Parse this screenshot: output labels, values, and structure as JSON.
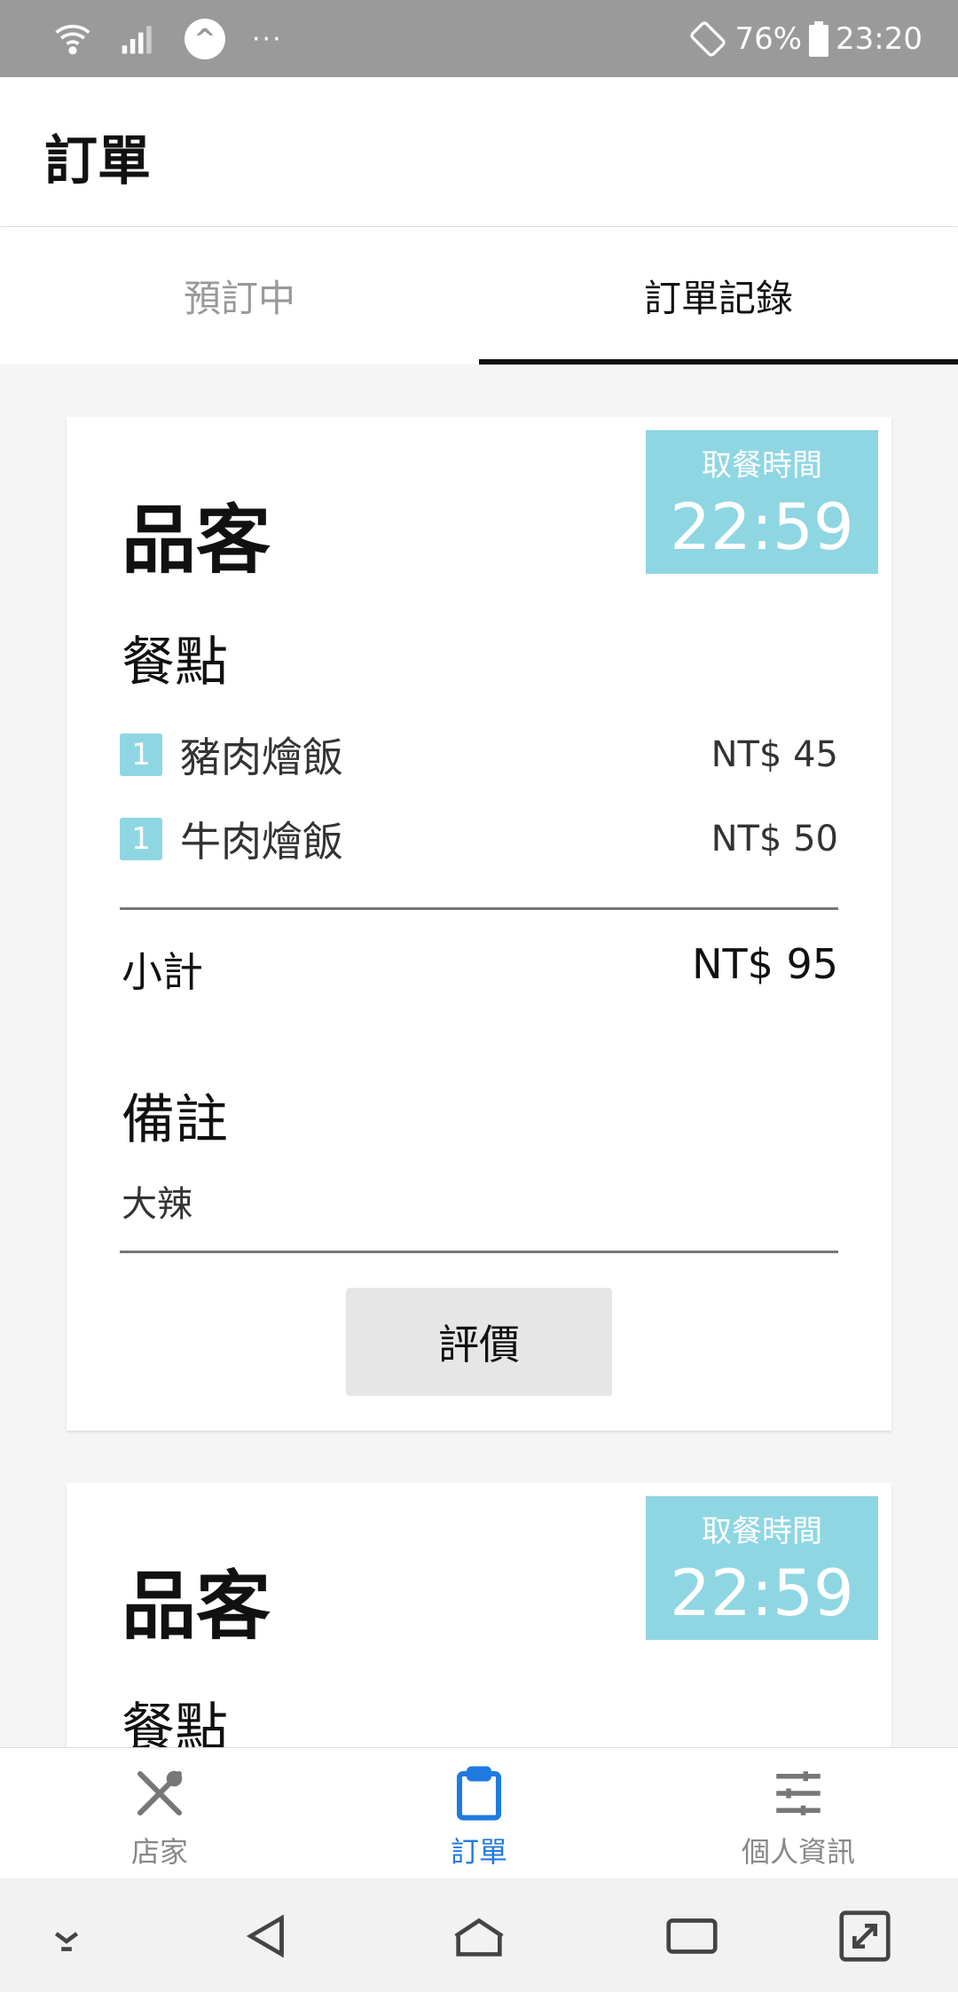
{
  "status_bar": {
    "battery": "76%",
    "time": "23:20",
    "app_glyph": "^",
    "dots": "···"
  },
  "app_bar": {
    "title": "訂單"
  },
  "tabs": [
    {
      "label": "預訂中",
      "active": false
    },
    {
      "label": "訂單記錄",
      "active": true
    }
  ],
  "orders": [
    {
      "shop": "品客",
      "pickup_label": "取餐時間",
      "pickup_time": "22:59",
      "items_title": "餐點",
      "items": [
        {
          "qty": "1",
          "name": "豬肉燴飯",
          "price": "NT$ 45"
        },
        {
          "qty": "1",
          "name": "牛肉燴飯",
          "price": "NT$ 50"
        }
      ],
      "subtotal_label": "小計",
      "subtotal_value": "NT$ 95",
      "notes_title": "備註",
      "notes": "大辣",
      "rate_button": "評價"
    },
    {
      "shop": "品客",
      "pickup_label": "取餐時間",
      "pickup_time": "22:59",
      "items_title": "餐點"
    }
  ],
  "bottom_nav": [
    {
      "label": "店家",
      "icon": "fork-knife-icon",
      "active": false
    },
    {
      "label": "訂單",
      "icon": "clipboard-icon",
      "active": true
    },
    {
      "label": "個人資訊",
      "icon": "sliders-icon",
      "active": false
    }
  ],
  "colors": {
    "accent": "#8fd6e3",
    "active_nav": "#1f7ae0",
    "status_bar": "#9a9a9a"
  }
}
